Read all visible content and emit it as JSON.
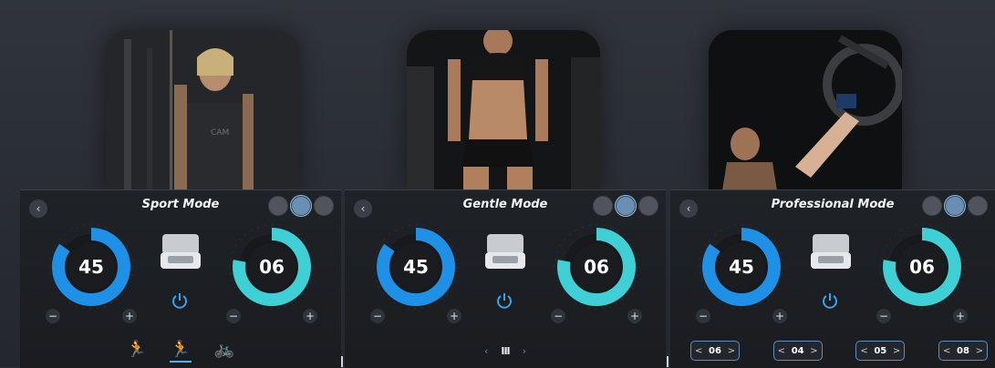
{
  "colors": {
    "accent_blue": "#1e90e6",
    "accent_teal": "#3fd0d6",
    "panel": "#1c1f24"
  },
  "panels": [
    {
      "title": "Sport Mode",
      "left_value": "45",
      "right_value": "06",
      "left_fraction": 0.85,
      "right_fraction": 0.78,
      "footer": {
        "type": "mode-icons",
        "icons": [
          "run-icon",
          "sprint-icon",
          "cycle-icon"
        ],
        "active": 1
      }
    },
    {
      "title": "Gentle Mode",
      "left_value": "45",
      "right_value": "06",
      "left_fraction": 0.85,
      "right_fraction": 0.78,
      "footer": {
        "type": "pager",
        "prev": "‹",
        "pause": "III",
        "next": "›"
      }
    },
    {
      "title": "Professional Mode",
      "left_value": "45",
      "right_value": "06",
      "left_fraction": 0.85,
      "right_fraction": 0.78,
      "footer": {
        "type": "steppers",
        "values": [
          "06",
          "04",
          "05",
          "08"
        ]
      }
    }
  ],
  "symbols": {
    "back": "‹",
    "minus": "−",
    "plus": "+",
    "left_arrow": "<",
    "right_arrow": ">"
  }
}
